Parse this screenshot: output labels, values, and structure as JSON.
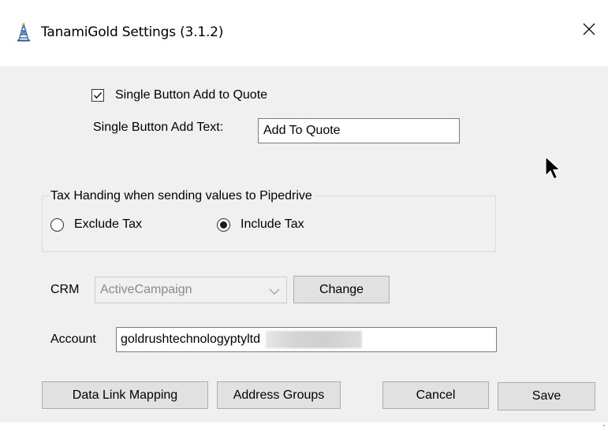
{
  "window": {
    "title": "TanamiGold Settings (3.1.2)",
    "app_icon": "oil-derrick-icon",
    "close_icon": "close-icon"
  },
  "single_button": {
    "checkbox_label": "Single Button Add to Quote",
    "checked": true,
    "add_text_label": "Single Button Add Text:",
    "add_text_value": "Add To Quote"
  },
  "tax": {
    "group_label": "Tax Handing when sending values to Pipedrive",
    "options": [
      {
        "label": "Exclude Tax",
        "selected": false
      },
      {
        "label": "Include Tax",
        "selected": true
      }
    ]
  },
  "crm": {
    "label": "CRM",
    "selected": "ActiveCampaign",
    "change_label": "Change"
  },
  "account": {
    "label": "Account",
    "value": "goldrushtechnologyptyltd"
  },
  "buttons": {
    "data_link_mapping": "Data Link Mapping",
    "address_groups": "Address Groups",
    "cancel": "Cancel",
    "save": "Save"
  },
  "colors": {
    "window_bg": "#f0f0f0",
    "titlebar_bg": "#ffffff",
    "button_bg": "#e1e1e1",
    "button_border": "#adadad"
  }
}
